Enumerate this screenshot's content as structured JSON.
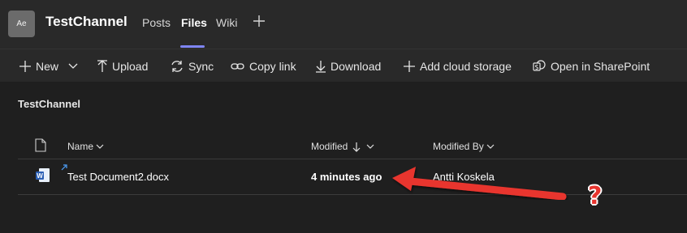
{
  "header": {
    "avatar_initials": "Ae",
    "channel_name": "TestChannel",
    "tabs": [
      {
        "label": "Posts"
      },
      {
        "label": "Files"
      },
      {
        "label": "Wiki"
      }
    ],
    "active_tab": "Files",
    "add_tab_icon": "plus-icon"
  },
  "toolbar": {
    "new_label": "New",
    "upload_label": "Upload",
    "sync_label": "Sync",
    "copy_link_label": "Copy link",
    "download_label": "Download",
    "add_cloud_label": "Add cloud storage",
    "sharepoint_label": "Open in SharePoint"
  },
  "page": {
    "title": "TestChannel"
  },
  "file_list": {
    "columns": {
      "name": "Name",
      "modified": "Modified",
      "modified_by": "Modified By"
    },
    "rows": [
      {
        "name": "Test Document2.docx",
        "modified": "4 minutes ago",
        "modified_by": "Antti Koskela",
        "file_type_icon": "word-doc-icon"
      }
    ]
  },
  "annotation": {
    "question_mark": "?",
    "arrow_color": "#e8352f"
  },
  "colors": {
    "accent": "#7f85f5",
    "background": "#1f1f1f",
    "header_background": "#292929"
  }
}
